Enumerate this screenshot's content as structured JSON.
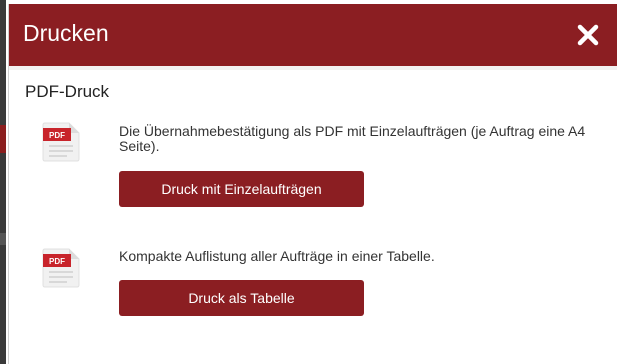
{
  "dialog": {
    "title": "Drucken",
    "close_icon": "close-icon"
  },
  "section": {
    "title": "PDF-Druck"
  },
  "items": [
    {
      "icon": "pdf-file-icon",
      "icon_badge": "PDF",
      "description": "Die Übernahmebestätigung als PDF mit Einzelaufträgen (je Auftrag eine A4 Seite).",
      "button_label": "Druck mit Einzelaufträgen"
    },
    {
      "icon": "pdf-file-icon",
      "icon_badge": "PDF",
      "description": "Kompakte Auflistung aller Aufträge in einer Tabelle.",
      "button_label": "Druck als Tabelle"
    }
  ],
  "colors": {
    "accent": "#8b1e22",
    "header_text": "#ffffff",
    "body_text": "#333333"
  }
}
